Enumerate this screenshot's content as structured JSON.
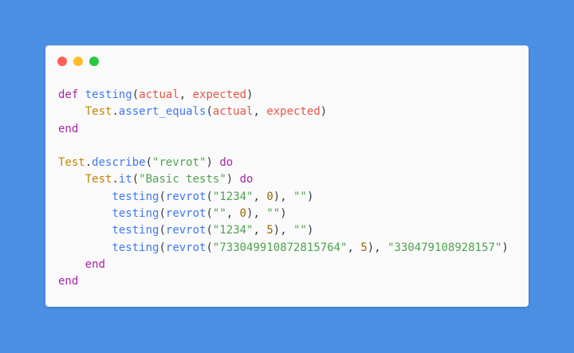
{
  "window": {
    "buttons": [
      {
        "name": "close",
        "color": "#ff5f56"
      },
      {
        "name": "minimize",
        "color": "#ffbd2e"
      },
      {
        "name": "maximize",
        "color": "#27c93f"
      }
    ]
  },
  "code": {
    "language": "ruby",
    "lines": [
      [
        {
          "t": "def",
          "k": "kw"
        },
        {
          "t": " ",
          "k": "pun"
        },
        {
          "t": "testing",
          "k": "fn"
        },
        {
          "t": "(",
          "k": "pun"
        },
        {
          "t": "actual",
          "k": "var"
        },
        {
          "t": ", ",
          "k": "pun"
        },
        {
          "t": "expected",
          "k": "var"
        },
        {
          "t": ")",
          "k": "pun"
        }
      ],
      [
        {
          "t": "    ",
          "k": "pun"
        },
        {
          "t": "Test",
          "k": "cls"
        },
        {
          "t": ".",
          "k": "pun"
        },
        {
          "t": "assert_equals",
          "k": "fn"
        },
        {
          "t": "(",
          "k": "pun"
        },
        {
          "t": "actual",
          "k": "var"
        },
        {
          "t": ", ",
          "k": "pun"
        },
        {
          "t": "expected",
          "k": "var"
        },
        {
          "t": ")",
          "k": "pun"
        }
      ],
      [
        {
          "t": "end",
          "k": "kw"
        }
      ],
      [],
      [
        {
          "t": "Test",
          "k": "cls"
        },
        {
          "t": ".",
          "k": "pun"
        },
        {
          "t": "describe",
          "k": "fn"
        },
        {
          "t": "(",
          "k": "pun"
        },
        {
          "t": "\"revrot\"",
          "k": "str"
        },
        {
          "t": ") ",
          "k": "pun"
        },
        {
          "t": "do",
          "k": "kw"
        }
      ],
      [
        {
          "t": "    ",
          "k": "pun"
        },
        {
          "t": "Test",
          "k": "cls"
        },
        {
          "t": ".",
          "k": "pun"
        },
        {
          "t": "it",
          "k": "fn"
        },
        {
          "t": "(",
          "k": "pun"
        },
        {
          "t": "\"Basic tests\"",
          "k": "str"
        },
        {
          "t": ") ",
          "k": "pun"
        },
        {
          "t": "do",
          "k": "kw"
        }
      ],
      [
        {
          "t": "        ",
          "k": "pun"
        },
        {
          "t": "testing",
          "k": "fn"
        },
        {
          "t": "(",
          "k": "pun"
        },
        {
          "t": "revrot",
          "k": "fn"
        },
        {
          "t": "(",
          "k": "pun"
        },
        {
          "t": "\"1234\"",
          "k": "str"
        },
        {
          "t": ", ",
          "k": "pun"
        },
        {
          "t": "0",
          "k": "num"
        },
        {
          "t": "), ",
          "k": "pun"
        },
        {
          "t": "\"\"",
          "k": "str"
        },
        {
          "t": ")",
          "k": "pun"
        }
      ],
      [
        {
          "t": "        ",
          "k": "pun"
        },
        {
          "t": "testing",
          "k": "fn"
        },
        {
          "t": "(",
          "k": "pun"
        },
        {
          "t": "revrot",
          "k": "fn"
        },
        {
          "t": "(",
          "k": "pun"
        },
        {
          "t": "\"\"",
          "k": "str"
        },
        {
          "t": ", ",
          "k": "pun"
        },
        {
          "t": "0",
          "k": "num"
        },
        {
          "t": "), ",
          "k": "pun"
        },
        {
          "t": "\"\"",
          "k": "str"
        },
        {
          "t": ")",
          "k": "pun"
        }
      ],
      [
        {
          "t": "        ",
          "k": "pun"
        },
        {
          "t": "testing",
          "k": "fn"
        },
        {
          "t": "(",
          "k": "pun"
        },
        {
          "t": "revrot",
          "k": "fn"
        },
        {
          "t": "(",
          "k": "pun"
        },
        {
          "t": "\"1234\"",
          "k": "str"
        },
        {
          "t": ", ",
          "k": "pun"
        },
        {
          "t": "5",
          "k": "num"
        },
        {
          "t": "), ",
          "k": "pun"
        },
        {
          "t": "\"\"",
          "k": "str"
        },
        {
          "t": ")",
          "k": "pun"
        }
      ],
      [
        {
          "t": "        ",
          "k": "pun"
        },
        {
          "t": "testing",
          "k": "fn"
        },
        {
          "t": "(",
          "k": "pun"
        },
        {
          "t": "revrot",
          "k": "fn"
        },
        {
          "t": "(",
          "k": "pun"
        },
        {
          "t": "\"733049910872815764\"",
          "k": "str"
        },
        {
          "t": ", ",
          "k": "pun"
        },
        {
          "t": "5",
          "k": "num"
        },
        {
          "t": "), ",
          "k": "pun"
        },
        {
          "t": "\"330479108928157\"",
          "k": "str"
        },
        {
          "t": ")",
          "k": "pun"
        }
      ],
      [
        {
          "t": "    ",
          "k": "pun"
        },
        {
          "t": "end",
          "k": "kw"
        }
      ],
      [
        {
          "t": "end",
          "k": "kw"
        }
      ]
    ]
  }
}
